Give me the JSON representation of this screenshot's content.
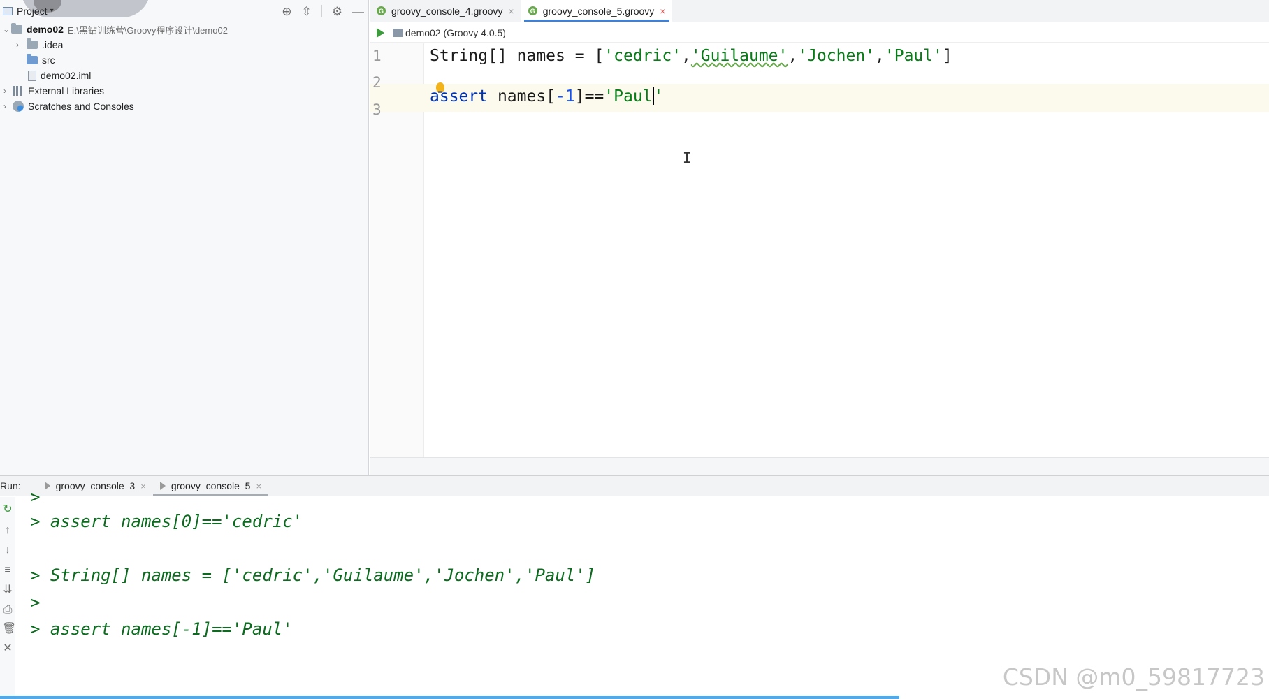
{
  "project_panel": {
    "title": "Project",
    "tools": [
      "crosshair-icon",
      "collapse-icon",
      "gear-icon",
      "minimize-icon"
    ],
    "tree": [
      {
        "name": "demo02",
        "path": "E:\\黑钻训练营\\Groovy程序设计\\demo02",
        "expanded": true
      },
      {
        "name": ".idea"
      },
      {
        "name": "src"
      },
      {
        "name": "demo02.iml"
      },
      {
        "name": "External Libraries"
      },
      {
        "name": "Scratches and Consoles"
      }
    ]
  },
  "editor_tabs": [
    {
      "label": "groovy_console_4.groovy",
      "active": false
    },
    {
      "label": "groovy_console_5.groovy",
      "active": true
    }
  ],
  "run_config": {
    "label": "demo02 (Groovy 4.0.5)"
  },
  "editor": {
    "line_numbers": [
      "1",
      "2",
      "3"
    ],
    "line1": {
      "kw": "String",
      "rest": "[] names = [",
      "s1": "'cedric'",
      "c1": ",",
      "s2": "'Guilaume'",
      "c2": ",",
      "s3": "'Jochen'",
      "c3": ",",
      "s4": "'Paul'",
      "end": "]"
    },
    "line3": {
      "kw": "assert",
      "pre": " names[",
      "num": "-1",
      "mid": "]==",
      "str_open": "'Paul",
      "str_close": "'"
    }
  },
  "run_panel": {
    "prefix": "Run:",
    "tabs": [
      {
        "label": "groovy_console_3",
        "active": false
      },
      {
        "label": "groovy_console_5",
        "active": true
      }
    ]
  },
  "console": {
    "lines": [
      ">",
      "> assert names[0]=='cedric'",
      "> String[] names = ['cedric','Guilaume','Jochen','Paul']",
      ">",
      "> assert names[-1]=='Paul'"
    ]
  },
  "watermark": "CSDN @m0_59817723",
  "colors": {
    "keyword": "#0033b3",
    "string": "#067d17",
    "number": "#1750eb",
    "console": "#0b6b1e",
    "tab_accent": "#3d82d8"
  }
}
